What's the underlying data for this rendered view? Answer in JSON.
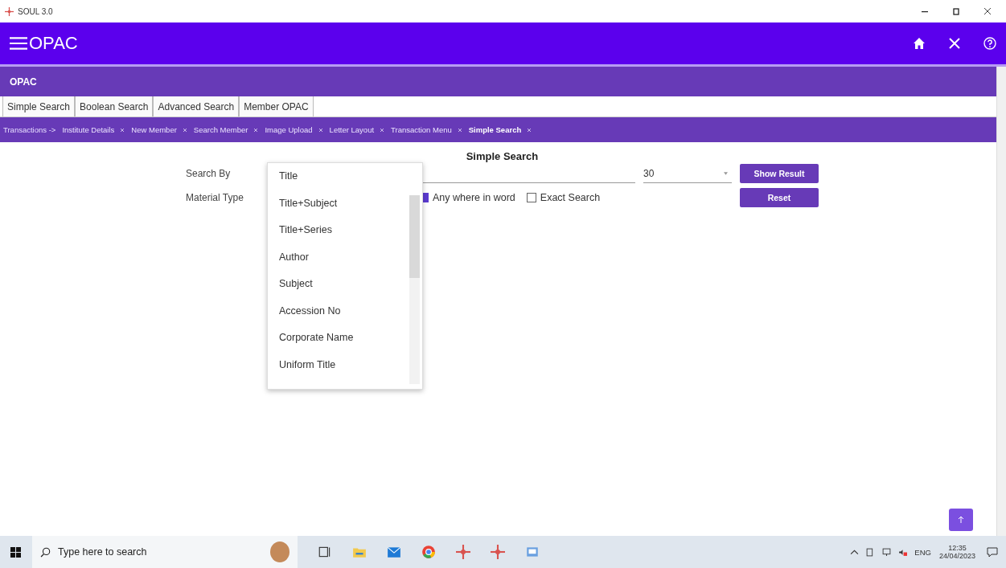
{
  "window": {
    "title": "SOUL 3.0"
  },
  "header": {
    "title": "OPAC"
  },
  "module_bar": {
    "title": "OPAC"
  },
  "tabs": [
    {
      "label": "Simple Search"
    },
    {
      "label": "Boolean Search"
    },
    {
      "label": "Advanced Search"
    },
    {
      "label": "Member OPAC"
    }
  ],
  "breadcrumb": {
    "label": "Transactions ->",
    "items": [
      {
        "label": "Institute Details",
        "selected": false
      },
      {
        "label": "New Member",
        "selected": false
      },
      {
        "label": "Search Member",
        "selected": false
      },
      {
        "label": "Image Upload",
        "selected": false
      },
      {
        "label": "Letter Layout",
        "selected": false
      },
      {
        "label": "Transaction Menu",
        "selected": false
      },
      {
        "label": "Simple Search",
        "selected": true
      }
    ]
  },
  "form": {
    "heading": "Simple Search",
    "search_by_label": "Search By",
    "material_type_label": "Material Type",
    "count": "30",
    "checkboxes": [
      {
        "label": "Any where in word",
        "checked": true
      },
      {
        "label": "Exact Search",
        "checked": false
      }
    ],
    "buttons": [
      "Show Result",
      "Reset"
    ]
  },
  "dropdown": {
    "options": [
      "Title",
      "Title+Subject",
      "Title+Series",
      "Author",
      "Subject",
      "Accession No",
      "Corporate Name",
      "Uniform Title"
    ]
  },
  "taskbar": {
    "search_placeholder": "Type here to search",
    "language": "ENG",
    "time": "12:35",
    "date": "24/04/2023"
  }
}
